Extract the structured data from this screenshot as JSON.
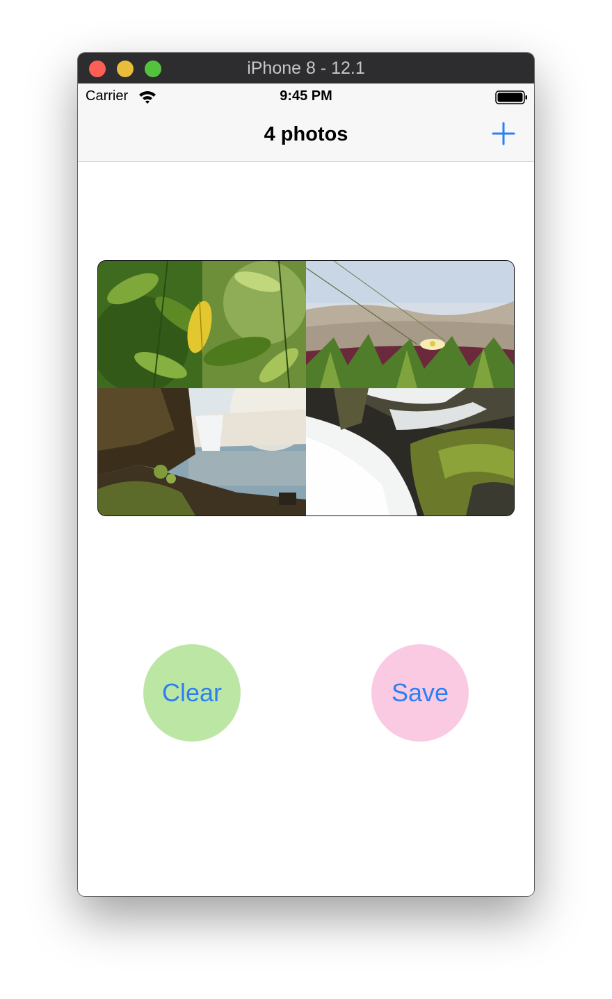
{
  "window": {
    "title": "iPhone 8 - 12.1"
  },
  "status_bar": {
    "carrier": "Carrier",
    "time": "9:45 PM"
  },
  "nav_bar": {
    "title": "4 photos",
    "add_icon": "plus-icon"
  },
  "collage": {
    "photos": [
      {
        "subject": "green leaves with yellow leaf"
      },
      {
        "subject": "flower in grass by dunes"
      },
      {
        "subject": "waterfall over mossy rocks"
      },
      {
        "subject": "cascading water over mossy rock"
      }
    ]
  },
  "buttons": {
    "clear_label": "Clear",
    "save_label": "Save",
    "clear_color": "#bce6a4",
    "save_color": "#f9cae2",
    "text_color": "#2d7ff4"
  }
}
